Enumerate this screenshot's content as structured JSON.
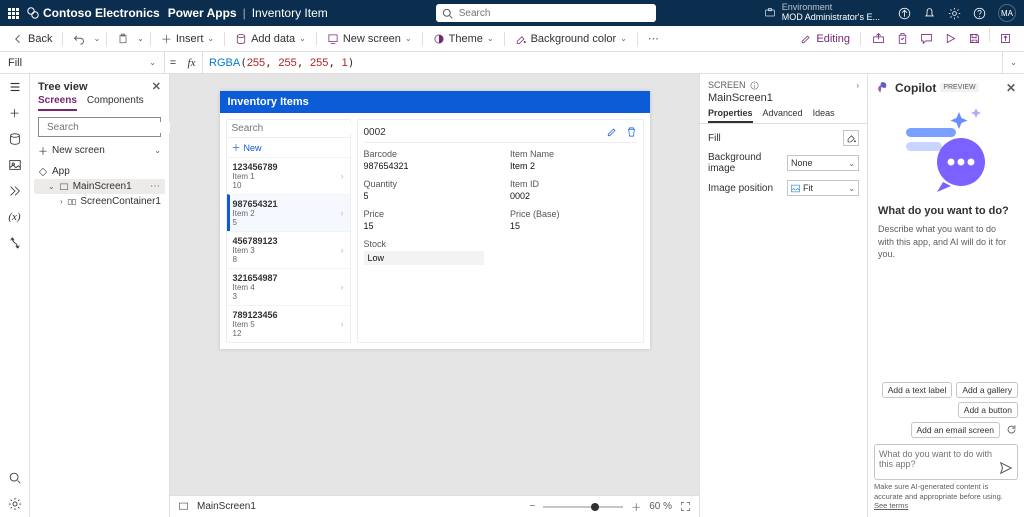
{
  "header": {
    "brand": "Contoso Electronics",
    "app": "Power Apps",
    "page": "Inventory Item",
    "search_placeholder": "Search",
    "env_label": "Environment",
    "env_value": "MOD Administrator's E...",
    "avatar": "MA"
  },
  "cmdbar": {
    "back": "Back",
    "insert": "Insert",
    "add_data": "Add data",
    "new_screen": "New screen",
    "theme": "Theme",
    "bg_color": "Background color",
    "editing": "Editing"
  },
  "formula": {
    "property": "Fill",
    "fn": "RGBA",
    "args": [
      "255",
      "255",
      "255",
      "1"
    ]
  },
  "tree": {
    "title": "Tree view",
    "tab_screens": "Screens",
    "tab_components": "Components",
    "search_placeholder": "Search",
    "new_screen": "New screen",
    "app": "App",
    "screen": "MainScreen1",
    "container": "ScreenContainer1"
  },
  "canvas": {
    "title": "Inventory Items",
    "list_search": "Search",
    "list_new": "New",
    "items": [
      {
        "barcode": "123456789",
        "name": "Item 1",
        "qty": "10"
      },
      {
        "barcode": "987654321",
        "name": "Item 2",
        "qty": "5"
      },
      {
        "barcode": "456789123",
        "name": "Item 3",
        "qty": "8"
      },
      {
        "barcode": "321654987",
        "name": "Item 4",
        "qty": "3"
      },
      {
        "barcode": "789123456",
        "name": "Item 5",
        "qty": "12"
      }
    ],
    "selected_index": 1,
    "detail": {
      "id": "0002",
      "fields": {
        "barcode_l": "Barcode",
        "barcode_v": "987654321",
        "itemname_l": "Item Name",
        "itemname_v": "Item 2",
        "quantity_l": "Quantity",
        "quantity_v": "5",
        "itemid_l": "Item ID",
        "itemid_v": "0002",
        "price_l": "Price",
        "price_v": "15",
        "pricebase_l": "Price (Base)",
        "pricebase_v": "15",
        "stock_l": "Stock",
        "stock_v": "Low"
      }
    },
    "footer_screen": "MainScreen1",
    "zoom": "60"
  },
  "props": {
    "kind": "SCREEN",
    "name": "MainScreen1",
    "tab_properties": "Properties",
    "tab_advanced": "Advanced",
    "tab_ideas": "Ideas",
    "fill": "Fill",
    "bgimage": "Background image",
    "bgimage_v": "None",
    "imgpos": "Image position",
    "imgpos_v": "Fit"
  },
  "copilot": {
    "title": "Copilot",
    "badge": "PREVIEW",
    "heading": "What do you want to do?",
    "sub": "Describe what you want to do with this app, and AI will do it for you.",
    "chips": [
      "Add a text label",
      "Add a gallery",
      "Add a button",
      "Add an email screen"
    ],
    "placeholder": "What do you want to do with this app?",
    "footer_a": "Make sure AI-generated content is accurate and appropriate before using.",
    "footer_link": "See terms"
  }
}
